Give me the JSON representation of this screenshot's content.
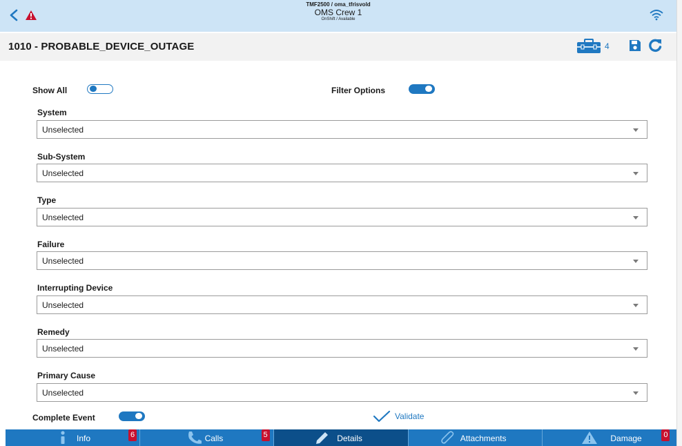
{
  "header": {
    "line1": "TMF2500 / oma_tfrisvold",
    "line2": "OMS Crew 1",
    "line3": "OnShift / Available"
  },
  "titlebar": {
    "title": "1010 - PROBABLE_DEVICE_OUTAGE",
    "toolbox_count": "4"
  },
  "controls": {
    "show_all_label": "Show All",
    "show_all_on": false,
    "filter_options_label": "Filter Options",
    "filter_options_on": true,
    "complete_event_label": "Complete Event",
    "complete_event_on": true,
    "validate_label": "Validate"
  },
  "fields": [
    {
      "label": "System",
      "value": "Unselected"
    },
    {
      "label": "Sub-System",
      "value": "Unselected"
    },
    {
      "label": "Type",
      "value": "Unselected"
    },
    {
      "label": "Failure",
      "value": "Unselected"
    },
    {
      "label": "Interrupting Device",
      "value": "Unselected"
    },
    {
      "label": "Remedy",
      "value": "Unselected"
    },
    {
      "label": "Primary Cause",
      "value": "Unselected"
    }
  ],
  "tabs": [
    {
      "label": "Info",
      "badge": "6",
      "icon": "info-icon"
    },
    {
      "label": "Calls",
      "badge": "5",
      "icon": "phone-icon"
    },
    {
      "label": "Details",
      "badge": "",
      "icon": "pencil-icon"
    },
    {
      "label": "Attachments",
      "badge": "",
      "icon": "paperclip-icon"
    },
    {
      "label": "Damage",
      "badge": "0",
      "icon": "warning-icon"
    }
  ],
  "colors": {
    "header_bg": "#cde4f6",
    "accent": "#1f78c1",
    "active_tab": "#0c4f8a",
    "alert": "#c8102e"
  }
}
